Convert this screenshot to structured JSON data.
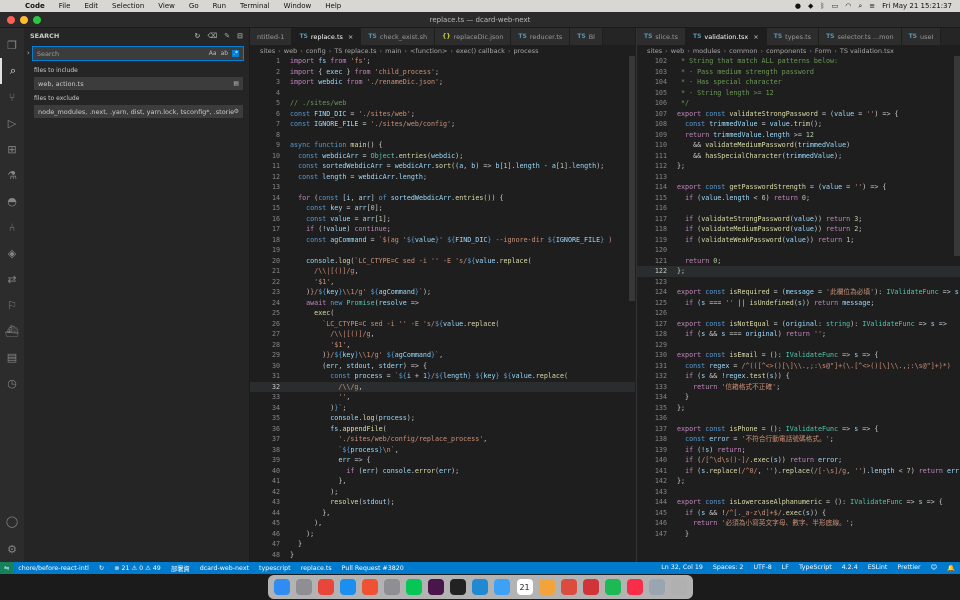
{
  "menubar": {
    "app": "Code",
    "items": [
      "File",
      "Edit",
      "Selection",
      "View",
      "Go",
      "Run",
      "Terminal",
      "Window",
      "Help"
    ],
    "clock": "Fri May 21  15:21:37"
  },
  "window": {
    "title": "replace.ts — dcard-web-next"
  },
  "sidebar": {
    "title": "SEARCH",
    "search_placeholder": "Search",
    "files_include_label": "files to include",
    "files_include_value": "web, action.ts",
    "files_exclude_label": "files to exclude",
    "files_exclude_value": "node_modules, .next, .yarn, dist, yarn.lock, tsconfig*, .stories.ts..."
  },
  "left_editor": {
    "tabs": [
      {
        "icon": "",
        "label": "ntitled-1",
        "active": false
      },
      {
        "icon": "TS",
        "label": "replace.ts",
        "active": true
      },
      {
        "icon": "TS",
        "label": "check_exist.sh",
        "active": false
      },
      {
        "icon": "{}",
        "label": "replaceDic.json",
        "active": false
      },
      {
        "icon": "TS",
        "label": "reducer.ts",
        "active": false
      },
      {
        "icon": "TS",
        "label": "Bl",
        "active": false
      }
    ],
    "breadcrumb": [
      "sites",
      "web",
      "config",
      "TS replace.ts",
      "main",
      "<function>",
      "exec() callback",
      "process"
    ],
    "first_line": 1,
    "current_line": 32,
    "lines": [
      "<span class='c'>import</span> <span class='v'>fs</span> <span class='c'>from</span> <span class='s'>'fs'</span>;",
      "<span class='c'>import</span> { <span class='v'>exec</span> } <span class='c'>from</span> <span class='s'>'child_process'</span>;",
      "<span class='c'>import</span> <span class='v'>webdic</span> <span class='c'>from</span> <span class='s'>'./renameDic.json'</span>;",
      "",
      "<span class='cm'>// ./sites/web</span>",
      "<span class='k'>const</span> <span class='v'>FIND_DIC</span> = <span class='s'>'./sites/web'</span>;",
      "<span class='k'>const</span> <span class='v'>IGNORE_FILE</span> = <span class='s'>'./sites/web/config'</span>;",
      "",
      "<span class='k'>async</span> <span class='k'>function</span> <span class='f'>main</span>() {",
      "  <span class='k'>const</span> <span class='v'>webdicArr</span> = <span class='t'>Object</span>.<span class='f'>entries</span>(<span class='v'>webdic</span>);",
      "  <span class='k'>const</span> <span class='v'>sortedWebdicArr</span> = <span class='v'>webdicArr</span>.<span class='f'>sort</span>((<span class='v'>a</span>, <span class='v'>b</span>) => <span class='v'>b</span>[<span class='n'>1</span>].<span class='v'>length</span> - <span class='v'>a</span>[<span class='n'>1</span>].<span class='v'>length</span>);",
      "  <span class='k'>const</span> <span class='v'>length</span> = <span class='v'>webdicArr</span>.<span class='v'>length</span>;",
      "",
      "  <span class='c'>for</span> (<span class='k'>const</span> [<span class='v'>i</span>, <span class='v'>arr</span>] <span class='k'>of</span> <span class='v'>sortedWebdicArr</span>.<span class='f'>entries</span>()) {",
      "    <span class='k'>const</span> <span class='v'>key</span> = <span class='v'>arr</span>[<span class='n'>0</span>];",
      "    <span class='k'>const</span> <span class='v'>value</span> = <span class='v'>arr</span>[<span class='n'>1</span>];",
      "    <span class='c'>if</span> (!<span class='v'>value</span>) <span class='c'>continue</span>;",
      "    <span class='k'>const</span> <span class='v'>agCommand</span> = <span class='s'>`$(ag '</span><span class='k'>${</span><span class='v'>value</span><span class='k'>}</span><span class='s'>' </span><span class='k'>${</span><span class='v'>FIND_DIC</span><span class='k'>}</span><span class='s'> --ignore-dir </span><span class='k'>${</span><span class='v'>IGNORE_FILE</span><span class='k'>}</span><span class='s'> )</span>",
      "",
      "    <span class='v'>console</span>.<span class='f'>log</span>(<span class='s'>`LC_CTYPE=C sed -i '' -E 's/</span><span class='k'>${</span><span class='v'>value</span>.<span class='f'>replace</span>(",
      "      <span class='s'>/\\\\|[()]/g</span>,",
      "      <span class='s'>'$1'</span>,",
      "    )<span class='s'>}/</span><span class='k'>${</span><span class='v'>key</span><span class='k'>}</span><span class='s'>\\\\1/g' </span><span class='k'>${</span><span class='v'>agCommand</span><span class='k'>}</span><span class='s'>`</span>);",
      "    <span class='c'>await</span> <span class='k'>new</span> <span class='t'>Promise</span>(<span class='v'>resolve</span> =>",
      "      <span class='f'>exec</span>(",
      "        <span class='s'>`LC_CTYPE=C sed -i '' -E 's/</span><span class='k'>${</span><span class='v'>value</span>.<span class='f'>replace</span>(",
      "          <span class='s'>/\\\\|[()]/g</span>,",
      "          <span class='s'>'$1'</span>,",
      "        )<span class='s'>}/</span><span class='k'>${</span><span class='v'>key</span><span class='k'>}</span><span class='s'>\\\\1/g' </span><span class='k'>${</span><span class='v'>agCommand</span><span class='k'>}</span><span class='s'>`</span>,",
      "        (<span class='v'>err</span>, <span class='v'>stdout</span>, <span class='v'>stderr</span>) => {",
      "          <span class='k'>const</span> <span class='v'>process</span> = <span class='s'>`</span><span class='k'>${</span><span class='v'>i</span> + <span class='n'>1</span><span class='k'>}</span><span class='s'>/</span><span class='k'>${</span><span class='v'>length</span><span class='k'>}</span><span class='s'> </span><span class='k'>${</span><span class='v'>key</span><span class='k'>}</span><span class='s'> </span><span class='k'>${</span><span class='v'>value</span>.<span class='f'>replace</span>(",
      "            <span class='s'>/\\\\/g</span>,",
      "            <span class='s'>''</span>,",
      "          )<span class='k'>}</span><span class='s'>`</span>;",
      "          <span class='v'>console</span>.<span class='f'>log</span>(<span class='v'>process</span>);",
      "          <span class='v'>fs</span>.<span class='f'>appendFile</span>(",
      "            <span class='s'>'./sites/web/config/replace_process'</span>,",
      "            <span class='s'>`</span><span class='k'>${</span><span class='v'>process</span><span class='k'>}</span><span class='s'>\\n`</span>,",
      "            <span class='v'>err</span> => {",
      "              <span class='c'>if</span> (<span class='v'>err</span>) <span class='v'>console</span>.<span class='f'>error</span>(<span class='v'>err</span>);",
      "            },",
      "          );",
      "          <span class='f'>resolve</span>(<span class='v'>stdout</span>);",
      "        },",
      "      ),",
      "    );",
      "  }",
      "}"
    ]
  },
  "right_editor": {
    "tabs": [
      {
        "icon": "TS",
        "label": "slice.ts",
        "active": false
      },
      {
        "icon": "TS",
        "label": "validation.tsx",
        "active": true
      },
      {
        "icon": "TS",
        "label": "types.ts",
        "active": false
      },
      {
        "icon": "TS",
        "label": "selector.ts ...mon",
        "active": false
      },
      {
        "icon": "TS",
        "label": "useI",
        "active": false
      }
    ],
    "breadcrumb": [
      "sites",
      "web",
      "modules",
      "common",
      "components",
      "Form",
      "TS validation.tsx"
    ],
    "first_line": 102,
    "current_line": 122,
    "lines": [
      "<span class='cm'> * String that match ALL patterns below:</span>",
      "<span class='cm'> * - Pass medium strength password</span>",
      "<span class='cm'> * - Has special character</span>",
      "<span class='cm'> * - String length >= 12</span>",
      "<span class='cm'> */</span>",
      "<span class='c'>export</span> <span class='k'>const</span> <span class='f'>validateStrongPassword</span> = (<span class='v'>value</span> = <span class='s'>''</span>) => {",
      "  <span class='k'>const</span> <span class='v'>trimmedValue</span> = <span class='v'>value</span>.<span class='f'>trim</span>();",
      "  <span class='c'>return</span> <span class='v'>trimmedValue</span>.<span class='v'>length</span> >= <span class='n'>12</span>",
      "    && <span class='f'>validateMediumPassword</span>(<span class='v'>trimmedValue</span>)",
      "    && <span class='f'>hasSpecialCharacter</span>(<span class='v'>trimmedValue</span>);",
      "};",
      "",
      "<span class='c'>export</span> <span class='k'>const</span> <span class='f'>getPasswordStrength</span> = (<span class='v'>value</span> = <span class='s'>''</span>) => {",
      "  <span class='c'>if</span> (<span class='v'>value</span>.<span class='v'>length</span> < <span class='n'>6</span>) <span class='c'>return</span> <span class='n'>0</span>;",
      "",
      "  <span class='c'>if</span> (<span class='f'>validateStrongPassword</span>(<span class='v'>value</span>)) <span class='c'>return</span> <span class='n'>3</span>;",
      "  <span class='c'>if</span> (<span class='f'>validateMediumPassword</span>(<span class='v'>value</span>)) <span class='c'>return</span> <span class='n'>2</span>;",
      "  <span class='c'>if</span> (<span class='f'>validateWeakPassword</span>(<span class='v'>value</span>)) <span class='c'>return</span> <span class='n'>1</span>;",
      "",
      "  <span class='c'>return</span> <span class='n'>0</span>;",
      "};",
      "",
      "<span class='c'>export</span> <span class='k'>const</span> <span class='f'>isRequired</span> = (<span class='v'>message</span> = <span class='s'>'此欄位為必填'</span>): <span class='t'>IValidateFunc</span> => <span class='v'>s</span> =",
      "  <span class='c'>if</span> (<span class='v'>s</span> === <span class='s'>''</span> || <span class='f'>isUndefined</span>(<span class='v'>s</span>)) <span class='c'>return</span> <span class='v'>message</span>;",
      "",
      "<span class='c'>export</span> <span class='k'>const</span> <span class='f'>isNotEqual</span> = (<span class='v'>original</span>: <span class='t'>string</span>): <span class='t'>IValidateFunc</span> => <span class='v'>s</span> =>",
      "  <span class='c'>if</span> (<span class='v'>s</span> && <span class='v'>s</span> === <span class='v'>original</span>) <span class='c'>return</span> <span class='s'>''</span>;",
      "",
      "<span class='c'>export</span> <span class='k'>const</span> <span class='f'>isEmail</span> = (): <span class='t'>IValidateFunc</span> => <span class='v'>s</span> => {",
      "  <span class='k'>const</span> <span class='v'>regex</span> = <span class='s'>/^(([^&lt;&gt;()[\\]\\\\.,;:\\s@\"]+(\\.[^&lt;&gt;()[\\]\\\\.,;:\\s@\"]+)*)</span>",
      "  <span class='c'>if</span> (<span class='v'>s</span> && !<span class='v'>regex</span>.<span class='f'>test</span>(<span class='v'>s</span>)) {",
      "    <span class='c'>return</span> <span class='s'>'信箱格式不正確'</span>;",
      "  }",
      "};",
      "",
      "<span class='c'>export</span> <span class='k'>const</span> <span class='f'>isPhone</span> = (): <span class='t'>IValidateFunc</span> => <span class='v'>s</span> => {",
      "  <span class='k'>const</span> <span class='v'>error</span> = <span class='s'>'不符合行動電話號碼格式。'</span>;",
      "  <span class='c'>if</span> (!<span class='v'>s</span>) <span class='c'>return</span>;",
      "  <span class='c'>if</span> (<span class='s'>/[^\\d\\s()-]/</span>.<span class='f'>exec</span>(<span class='v'>s</span>)) <span class='c'>return</span> <span class='v'>error</span>;",
      "  <span class='c'>if</span> (<span class='v'>s</span>.<span class='f'>replace</span>(<span class='s'>/^0/</span>, <span class='s'>''</span>).<span class='f'>replace</span>(<span class='s'>/[-\\s]/g</span>, <span class='s'>''</span>).<span class='v'>length</span> < <span class='n'>7</span>) <span class='c'>return</span> <span class='v'>err</span>",
      "};",
      "",
      "<span class='c'>export</span> <span class='k'>const</span> <span class='f'>isLowercaseAlphanumeric</span> = (): <span class='t'>IValidateFunc</span> => <span class='v'>s</span> => {",
      "  <span class='c'>if</span> (<span class='v'>s</span> && !<span class='s'>/^[._a-z\\d]+$/</span>.<span class='f'>exec</span>(<span class='v'>s</span>)) {",
      "    <span class='c'>return</span> <span class='s'>'必須為小寫英文字母、數字、半形底線。'</span>;",
      "  }"
    ]
  },
  "statusbar": {
    "branch": "chore/before-react-intl",
    "problems": "⊗ 21 ⚠ 0 ⚠ 49",
    "deploy": "部署資",
    "project": "dcard-web-next",
    "lang_service": "typescript",
    "file": "replace.ts",
    "pr": "Pull Request #3820",
    "position": "Ln 32, Col 19",
    "spaces": "Spaces: 2",
    "encoding": "UTF-8",
    "eol": "LF",
    "language": "TypeScript",
    "ts_version": "4.2.4",
    "eslint": "ESLint",
    "prettier": "Prettier"
  },
  "dock": {
    "apps": [
      {
        "icon": "finder-icon",
        "color": "#2f8cf0"
      },
      {
        "icon": "system-prefs-icon",
        "color": "#8e8e93"
      },
      {
        "icon": "chrome-icon",
        "color": "#e8463a"
      },
      {
        "icon": "safari-icon",
        "color": "#1c8ef0"
      },
      {
        "icon": "git-icon",
        "color": "#f05133"
      },
      {
        "icon": "notes-icon",
        "color": "#8e8e93"
      },
      {
        "icon": "line-icon",
        "color": "#06c755"
      },
      {
        "icon": "slack-icon",
        "color": "#4a154b"
      },
      {
        "icon": "terminal-icon",
        "color": "#222222"
      },
      {
        "icon": "vscode-icon",
        "color": "#1f8ad2"
      },
      {
        "icon": "finder2-icon",
        "color": "#3da1f5"
      },
      {
        "icon": "calendar-icon",
        "color": "#ffffff"
      },
      {
        "icon": "photos-icon",
        "color": "#f2a33b"
      },
      {
        "icon": "todoist-icon",
        "color": "#db4c3f"
      },
      {
        "icon": "office-icon",
        "color": "#d13438"
      },
      {
        "icon": "spotify-icon",
        "color": "#1db954"
      },
      {
        "icon": "music-icon",
        "color": "#fa2d48"
      },
      {
        "icon": "preview-icon",
        "color": "#9aa5b1"
      },
      {
        "icon": "trash-icon",
        "color": "#b0b0b0"
      }
    ],
    "calendar_day": "21"
  }
}
